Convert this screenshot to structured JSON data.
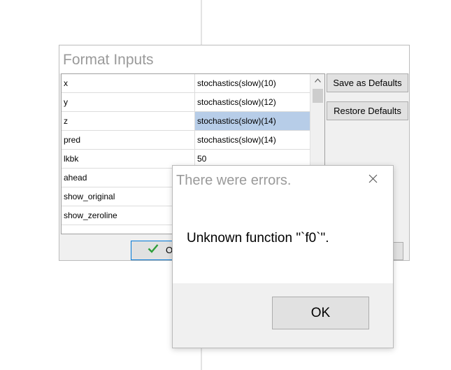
{
  "format_inputs": {
    "title": "Format Inputs",
    "rows": [
      {
        "name": "x",
        "value": "stochastics(slow)(10)",
        "selected": false
      },
      {
        "name": "y",
        "value": "stochastics(slow)(12)",
        "selected": false
      },
      {
        "name": "z",
        "value": "stochastics(slow)(14)",
        "selected": true
      },
      {
        "name": "pred",
        "value": "stochastics(slow)(14)",
        "selected": false
      },
      {
        "name": "lkbk",
        "value": "50",
        "selected": false
      },
      {
        "name": "ahead",
        "value": "",
        "selected": false
      },
      {
        "name": "show_original",
        "value": "",
        "selected": false
      },
      {
        "name": "show_zeroline",
        "value": "",
        "selected": false
      }
    ],
    "save_defaults_label": "Save as Defaults",
    "restore_defaults_label": "Restore Defaults",
    "ok_label_partial": "O",
    "scroll_up_glyph": "^"
  },
  "error_dialog": {
    "title": "There were errors.",
    "close_glyph": "✕",
    "message": "Unknown function \"`f0`\".",
    "ok_label": "OK"
  },
  "colors": {
    "selected_cell": "#b7cde8",
    "ok_check": "#2e9e3a",
    "focus_border": "#0078d7"
  },
  "icons": {
    "check": "check-icon",
    "close": "close-icon",
    "scroll_up": "chevron-up-icon"
  }
}
